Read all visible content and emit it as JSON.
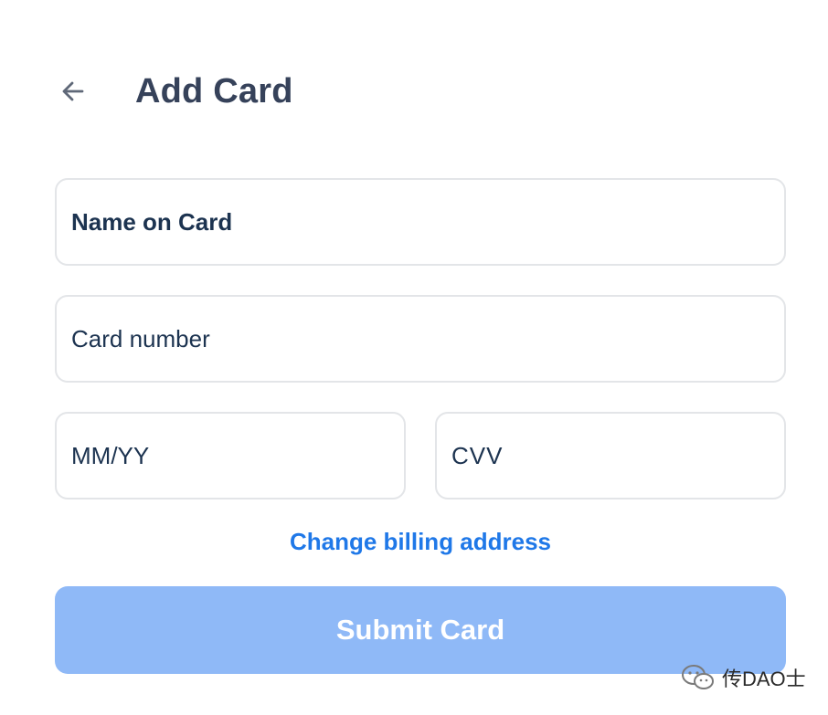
{
  "header": {
    "back_icon": "arrow-left-icon",
    "title": "Add Card"
  },
  "form": {
    "name_placeholder": "Name on Card",
    "card_number_placeholder": "Card number",
    "expiry_placeholder": "MM/YY",
    "cvv_placeholder": "CVV",
    "billing_link": "Change billing address",
    "submit_label": "Submit Card"
  },
  "watermark": {
    "icon": "wechat-icon",
    "text": "传DAO士"
  },
  "colors": {
    "title": "#36425a",
    "field_text": "#1c3350",
    "field_border": "#e3e5e8",
    "link": "#1f78e8",
    "submit_bg": "#8fb9f7",
    "submit_text": "#ffffff"
  }
}
